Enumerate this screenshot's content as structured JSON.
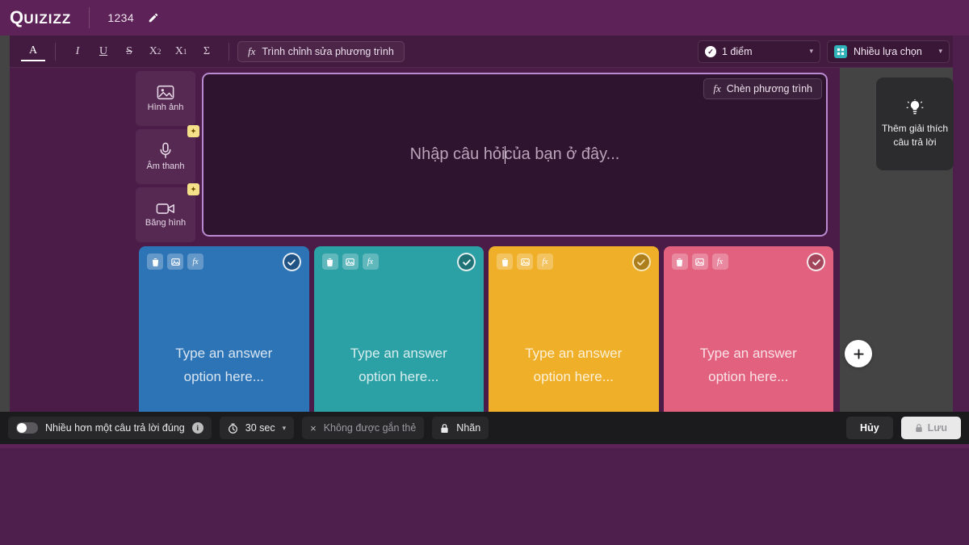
{
  "app": {
    "logo_q": "Q",
    "logo_rest": "UIZIZZ",
    "quiz_title": "1234",
    "edit_icon": "pencil-icon"
  },
  "toolbar": {
    "format_buttons": [
      {
        "name": "text-color",
        "label": "A",
        "active": true
      },
      {
        "name": "italic",
        "label": "I",
        "active": false
      },
      {
        "name": "underline",
        "label": "U",
        "active": false
      },
      {
        "name": "strikethrough",
        "label": "S",
        "active": false
      },
      {
        "name": "superscript",
        "label": "X",
        "sup": "2",
        "active": false
      },
      {
        "name": "subscript",
        "label": "X",
        "sub": "1",
        "active": false
      },
      {
        "name": "symbol",
        "label": "Σ",
        "active": false
      }
    ],
    "equation_editor_label": "Trình chỉnh sửa phương trình",
    "equation_glyph": "fx",
    "points_select": {
      "value": "1 điểm",
      "icon": "check-circle-icon",
      "caret": "▾"
    },
    "type_select": {
      "value": "Nhiều lựa chọn",
      "icon": "multiple-choice-icon",
      "caret": "▾"
    }
  },
  "media_rail": [
    {
      "name": "image",
      "label": "Hình ảnh",
      "icon": "image-icon",
      "badge": ""
    },
    {
      "name": "audio",
      "label": "Âm thanh",
      "icon": "microphone-icon",
      "badge": "✦"
    },
    {
      "name": "video",
      "label": "Băng hình",
      "icon": "video-camera-icon",
      "badge": "✦"
    }
  ],
  "question": {
    "placeholder_before": "Nhập câu hỏi ",
    "placeholder_after": "của bạn ở đây...",
    "insert_equation_label": "Chèn phương trình",
    "insert_equation_glyph": "fx"
  },
  "answers": {
    "placeholder": "Type an answer option here...",
    "options": [
      {
        "name": "answer-option-1",
        "color": "#2d74b6",
        "placeholder": "Type an answer option here..."
      },
      {
        "name": "answer-option-2",
        "color": "#2ba0a5",
        "placeholder": "Type an answer option here..."
      },
      {
        "name": "answer-option-3",
        "color": "#efaf28",
        "placeholder": "Type an answer option here..."
      },
      {
        "name": "answer-option-4",
        "color": "#e2617e",
        "placeholder": "Type an answer option here..."
      }
    ],
    "tools": [
      "delete-icon",
      "image-icon",
      "equation-icon"
    ],
    "add_button_label": "+"
  },
  "right_panel": {
    "explanation_label": "Thêm giải thích câu trả lời",
    "explanation_icon": "lightbulb-icon"
  },
  "bottom_bar": {
    "multi_answer_label": "Nhiều hơn một câu trả lời đúng",
    "multi_answer_on": false,
    "info_glyph": "i",
    "timer_value": "30 sec",
    "timer_icon": "clock-icon",
    "timer_caret": "▾",
    "tag_x": "×",
    "tag_label": "Không được gắn thẻ",
    "label_icon": "lock-icon",
    "label_text": "Nhãn",
    "cancel_label": "Hủy",
    "save_label": "Lưu",
    "save_icon": "lock-icon",
    "save_disabled": true
  },
  "colors": {
    "brand_purple": "#5d2257",
    "editor_bg": "#4b1c48",
    "question_bg": "#2f1430",
    "question_border": "#b98ad0",
    "scrim": "#444444",
    "bottom_bar": "#1b1a1d"
  }
}
